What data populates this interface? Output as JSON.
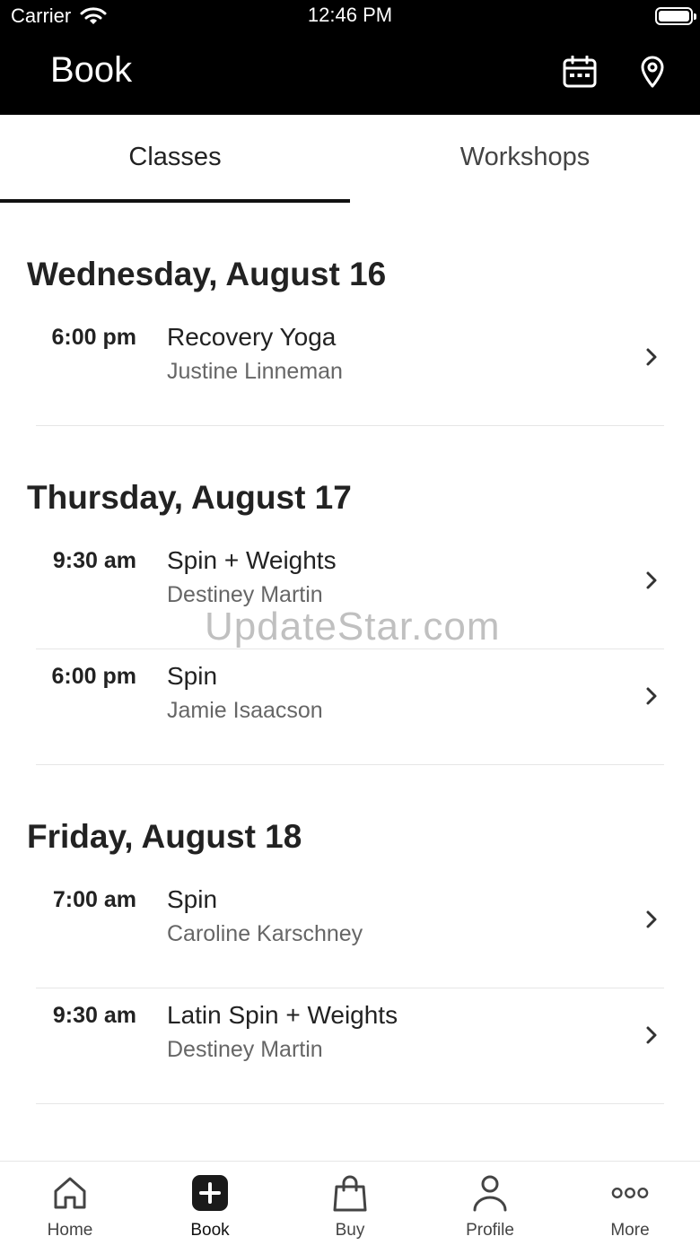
{
  "status_bar": {
    "carrier": "Carrier",
    "time": "12:46 PM"
  },
  "nav": {
    "title": "Book",
    "icons": [
      "calendar-icon",
      "location-pin-icon"
    ]
  },
  "tabs": [
    {
      "label": "Classes",
      "active": true
    },
    {
      "label": "Workshops",
      "active": false
    }
  ],
  "days": [
    {
      "date": "Wednesday, August 16",
      "classes": [
        {
          "time": "6:00 pm",
          "name": "Recovery Yoga",
          "instructor": "Justine Linneman"
        }
      ]
    },
    {
      "date": "Thursday, August 17",
      "classes": [
        {
          "time": "9:30 am",
          "name": "Spin + Weights",
          "instructor": "Destiney Martin"
        },
        {
          "time": "6:00 pm",
          "name": "Spin",
          "instructor": "Jamie Isaacson"
        }
      ]
    },
    {
      "date": "Friday, August 18",
      "classes": [
        {
          "time": "7:00 am",
          "name": "Spin",
          "instructor": "Caroline Karschney"
        },
        {
          "time": "9:30 am",
          "name": "Latin Spin + Weights",
          "instructor": "Destiney Martin"
        }
      ]
    }
  ],
  "watermark": "UpdateStar.com",
  "tabbar": [
    {
      "label": "Home",
      "icon": "home-icon",
      "active": false
    },
    {
      "label": "Book",
      "icon": "plus-square-icon",
      "active": true
    },
    {
      "label": "Buy",
      "icon": "shopping-bag-icon",
      "active": false
    },
    {
      "label": "Profile",
      "icon": "person-icon",
      "active": false
    },
    {
      "label": "More",
      "icon": "more-dots-icon",
      "active": false
    }
  ]
}
